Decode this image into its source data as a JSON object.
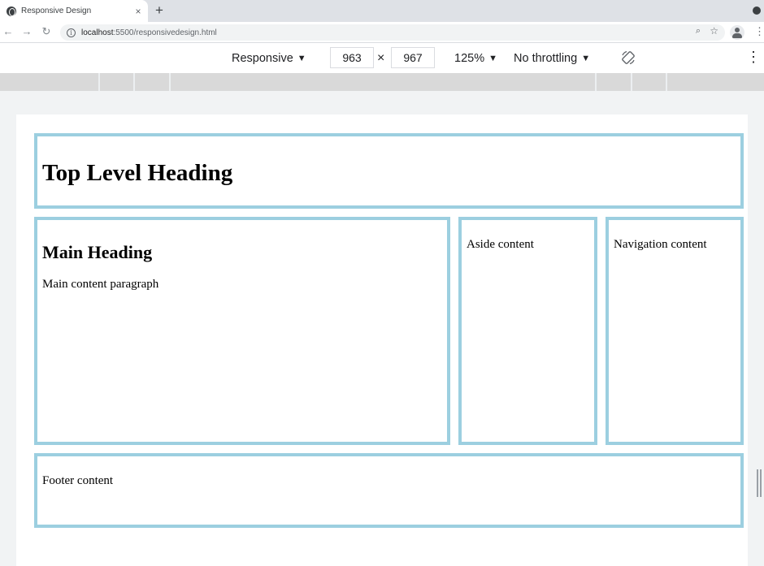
{
  "browser": {
    "tab_title": "Responsive Design",
    "tab_close": "×",
    "new_tab": "+",
    "url_host": "localhost",
    "url_rest": ":5500/responsivedesign.html",
    "icons": [
      "globe-icon",
      "back-icon",
      "forward-icon",
      "reload-icon",
      "info-icon",
      "zoom-icon",
      "star-icon",
      "profile-icon",
      "kebab-icon"
    ]
  },
  "device_toolbar": {
    "device": "Responsive",
    "width": "963",
    "times": "×",
    "height": "967",
    "zoom": "125%",
    "throttling": "No throttling",
    "dropdown_arrow": "▼",
    "more": "⋮"
  },
  "page": {
    "header_heading": "Top Level Heading",
    "main_heading": "Main Heading",
    "main_paragraph": "Main content paragraph",
    "aside_text": "Aside content",
    "nav_text": "Navigation content",
    "footer_text": "Footer content",
    "box_border_color": "#9ccfe0"
  }
}
